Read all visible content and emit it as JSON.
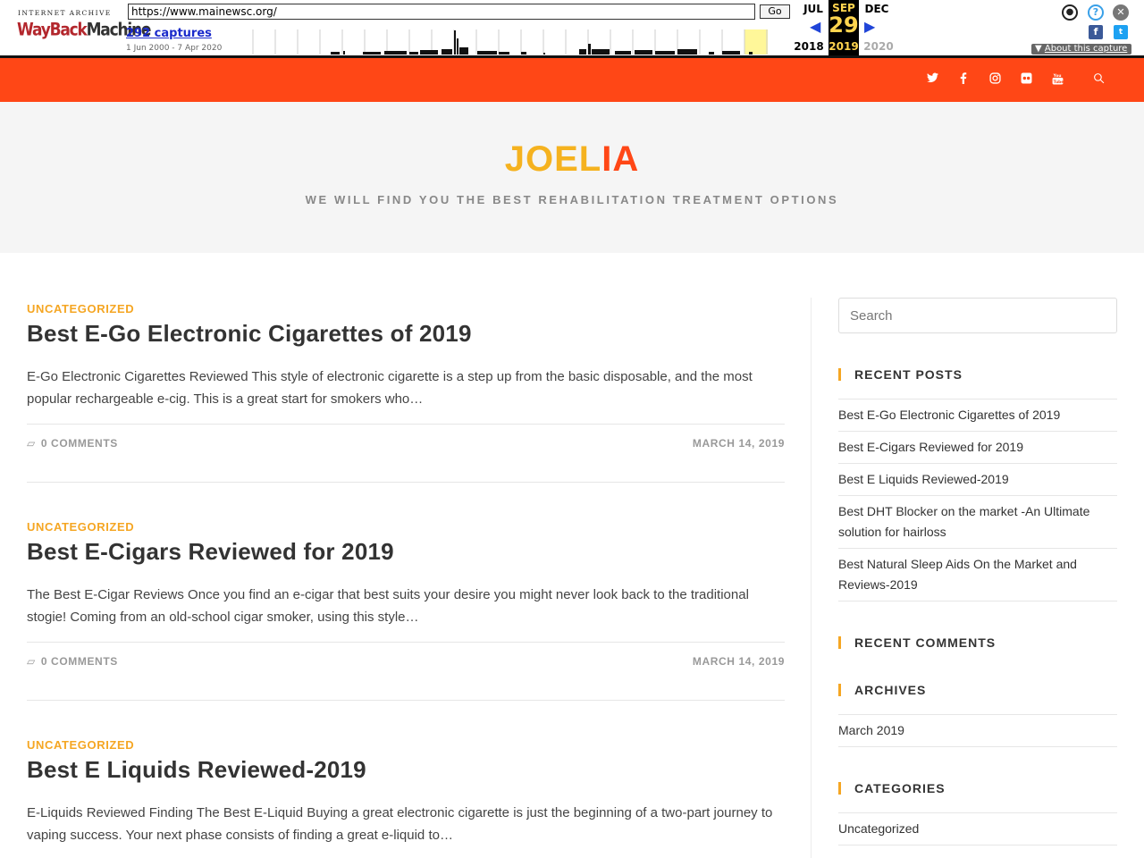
{
  "wayback": {
    "logo_top": "INTERNET ARCHIVE",
    "logo_wayback": "WayBack",
    "logo_machine": "Machine",
    "url": "https://www.mainewsc.org/",
    "go_label": "Go",
    "captures_label": "292 captures",
    "date_range": "1 Jun 2000 - 7 Apr 2020",
    "prev_month": "JUL",
    "cur_month": "SEP",
    "next_month": "DEC",
    "cur_day": "29",
    "prev_year": "2018",
    "cur_year": "2019",
    "next_year": "2020",
    "about_label": "About this capture"
  },
  "topbar": {
    "social": [
      "twitter-icon",
      "facebook-icon",
      "instagram-icon",
      "flickr-icon",
      "youtube-icon",
      "search-icon"
    ],
    "color": "#ff4716"
  },
  "site": {
    "logo_part1": "JOEL",
    "logo_part2": "IA",
    "tagline": "WE WILL FIND YOU THE BEST REHABILITATION TREATMENT OPTIONS"
  },
  "posts": [
    {
      "category": "UNCATEGORIZED",
      "title": "Best E-Go Electronic Cigarettes of 2019",
      "excerpt": "E-Go Electronic Cigarettes Reviewed This style of electronic cigarette is a step up from the basic disposable, and the most popular rechargeable e-cig. This is a great start for smokers who…",
      "comments": "0 COMMENTS",
      "date": "MARCH 14, 2019"
    },
    {
      "category": "UNCATEGORIZED",
      "title": "Best E-Cigars Reviewed for 2019",
      "excerpt": "The Best E-Cigar Reviews Once you find an e-cigar that best suits your desire you might never look back to the traditional stogie! Coming from an old-school cigar smoker, using this style…",
      "comments": "0 COMMENTS",
      "date": "MARCH 14, 2019"
    },
    {
      "category": "UNCATEGORIZED",
      "title": "Best E Liquids Reviewed-2019",
      "excerpt": "E-Liquids Reviewed Finding The Best E-Liquid Buying a great electronic cigarette is just the beginning of a two-part journey to vaping success. Your next phase consists of finding a great e-liquid to…"
    }
  ],
  "sidebar": {
    "search_placeholder": "Search",
    "recent_posts_title": "RECENT POSTS",
    "recent_posts": [
      "Best E-Go Electronic Cigarettes of 2019",
      "Best E-Cigars Reviewed for 2019",
      "Best E Liquids Reviewed-2019",
      "Best DHT Blocker on the market -An Ultimate solution for hairloss",
      "Best Natural Sleep Aids On the Market and Reviews-2019"
    ],
    "recent_comments_title": "RECENT COMMENTS",
    "archives_title": "ARCHIVES",
    "archives": [
      "March 2019"
    ],
    "categories_title": "CATEGORIES",
    "categories": [
      "Uncategorized"
    ]
  }
}
